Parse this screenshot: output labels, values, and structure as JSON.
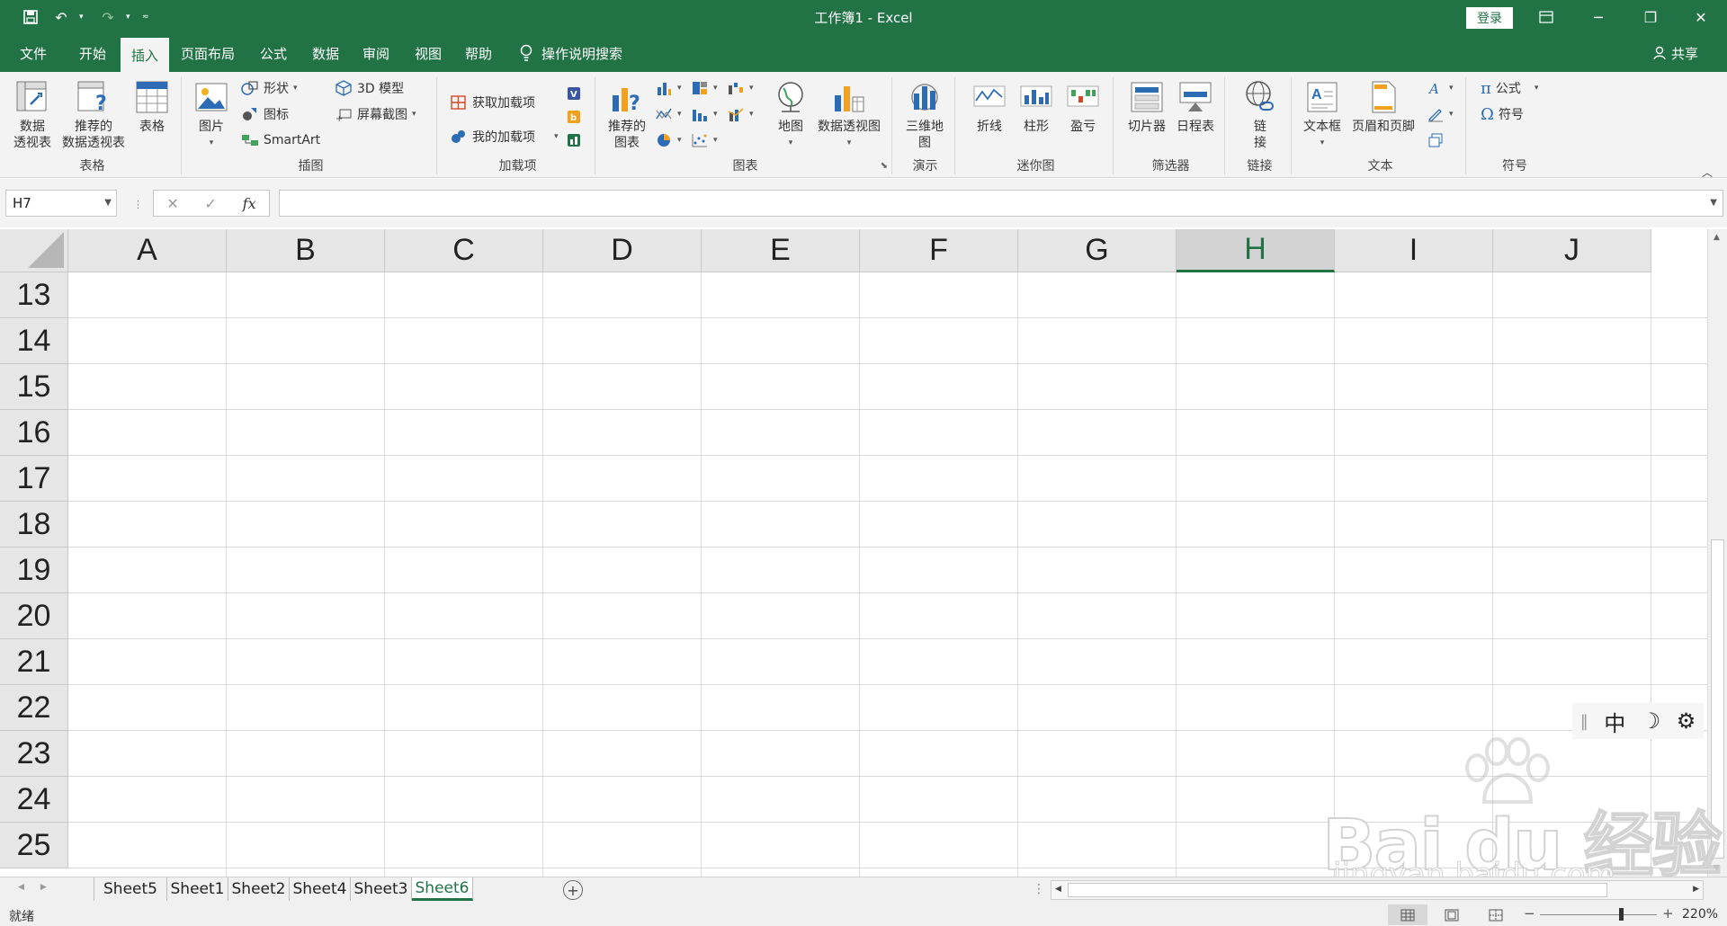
{
  "titlebar": {
    "title": "工作簿1  -  Excel",
    "login": "登录"
  },
  "menu": {
    "tabs": [
      "文件",
      "开始",
      "插入",
      "页面布局",
      "公式",
      "数据",
      "审阅",
      "视图",
      "帮助"
    ],
    "active": "插入",
    "tell_me": "操作说明搜索",
    "share": "共享"
  },
  "ribbon": {
    "groups": {
      "tables": "表格",
      "illustrations": "插图",
      "addins": "加载项",
      "charts": "图表",
      "tours": "演示",
      "sparklines": "迷你图",
      "filters": "筛选器",
      "links": "链接",
      "text": "文本",
      "symbols": "符号"
    },
    "buttons": {
      "pivot_table": [
        "数据",
        "透视表"
      ],
      "recommended_pivot": [
        "推荐的",
        "数据透视表"
      ],
      "table": "表格",
      "picture": "图片",
      "shapes": "形状",
      "icons": "图标",
      "smartart": "SmartArt",
      "model3d": "3D 模型",
      "screenshot": "屏幕截图",
      "get_addins": "获取加载项",
      "my_addins": "我的加载项",
      "recommended_charts": [
        "推荐的",
        "图表"
      ],
      "maps": "地图",
      "pivot_chart": "数据透视图",
      "map3d": [
        "三维地",
        "图"
      ],
      "line": "折线",
      "column": "柱形",
      "winloss": "盈亏",
      "slicer": "切片器",
      "timeline": "日程表",
      "link": [
        "链",
        "接"
      ],
      "textbox": "文本框",
      "header_footer": "页眉和页脚",
      "equation": "公式",
      "symbol": "符号"
    }
  },
  "formula_bar": {
    "name_box": "H7",
    "fx": "fx",
    "formula": ""
  },
  "grid": {
    "columns": [
      "A",
      "B",
      "C",
      "D",
      "E",
      "F",
      "G",
      "H",
      "I",
      "J"
    ],
    "selected_column": "H",
    "rows": [
      "13",
      "14",
      "15",
      "16",
      "17",
      "18",
      "19",
      "20",
      "21",
      "22",
      "23",
      "24",
      "25"
    ]
  },
  "ime": {
    "lang": "中"
  },
  "sheets": {
    "tabs": [
      "Sheet5",
      "Sheet1",
      "Sheet2",
      "Sheet4",
      "Sheet3",
      "Sheet6"
    ],
    "active": "Sheet6"
  },
  "status": {
    "ready": "就绪",
    "zoom": "220%"
  },
  "watermark": {
    "brand": "Bai du 经验",
    "url": "jingyan.baidu.com"
  },
  "colors": {
    "accent": "#217346"
  }
}
